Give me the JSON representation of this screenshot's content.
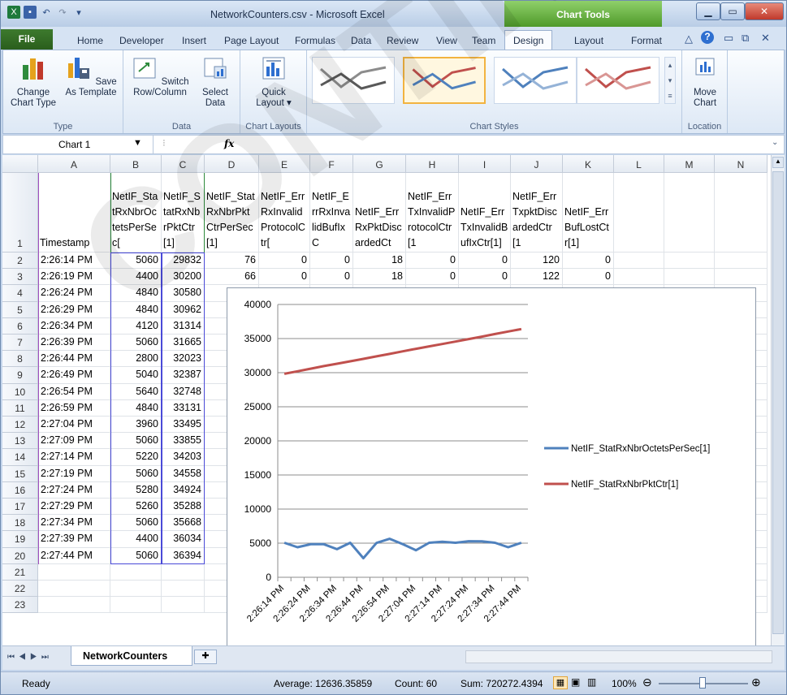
{
  "app": {
    "title": "NetworkCounters.csv - Microsoft Excel",
    "chart_tools": "Chart Tools"
  },
  "tabs": [
    "File",
    "Home",
    "Developer",
    "Insert",
    "Page Layout",
    "Formulas",
    "Data",
    "Review",
    "View",
    "Team",
    "Design",
    "Layout",
    "Format"
  ],
  "ribbon": {
    "type_group": {
      "label": "Type",
      "change": "Change Chart Type",
      "save": "Save As Template"
    },
    "data_group": {
      "label": "Data",
      "switch": "Switch Row/Column",
      "select": "Select Data"
    },
    "layouts_group": {
      "label": "Chart Layouts",
      "quick": "Quick Layout"
    },
    "styles_group": {
      "label": "Chart Styles",
      "style_colors": [
        [
          "#8c8c8c",
          "#595959"
        ],
        [
          "#c0504d",
          "#4f81bd"
        ],
        [
          "#4f81bd",
          "#95b3d7"
        ],
        [
          "#c0504d",
          "#d99694"
        ]
      ]
    },
    "location_group": {
      "label": "Location",
      "move": "Move Chart"
    }
  },
  "formula_bar": {
    "name_box": "Chart 1",
    "fx": "fx",
    "value": ""
  },
  "columns": [
    "A",
    "B",
    "C",
    "D",
    "E",
    "F",
    "G",
    "H",
    "I",
    "J",
    "K",
    "L",
    "M",
    "N"
  ],
  "header_row": [
    "Timestamp",
    "NetIF_StatRxNbrOctetsPerSec[",
    "NetIF_StatRxNbrPktCtr[1]",
    "NetIF_StatRxNbrPktCtrPerSec[1]",
    "NetIF_ErrRxInvalidProtocolCtr[",
    "NetIF_ErrRxInvalidBufIxC",
    "NetIF_ErrRxPktDiscardedCt",
    "NetIF_ErrTxInvalidProtocolCtr[1",
    "NetIF_ErrTxInvalidBufIxCtr[1]",
    "NetIF_ErrTxpktDiscardedCtr[1",
    "NetIF_ErrBufLostCtr[1]"
  ],
  "rows": [
    {
      "n": "2",
      "a": "2:26:14 PM",
      "b": "5060",
      "c": "29832",
      "d": "76",
      "e": "0",
      "f": "0",
      "g": "18",
      "h": "0",
      "i": "0",
      "j": "120",
      "k": "0"
    },
    {
      "n": "3",
      "a": "2:26:19 PM",
      "b": "4400",
      "c": "30200",
      "d": "66",
      "e": "0",
      "f": "0",
      "g": "18",
      "h": "0",
      "i": "0",
      "j": "122",
      "k": "0"
    },
    {
      "n": "4",
      "a": "2:26:24 PM",
      "b": "4840",
      "c": "30580"
    },
    {
      "n": "5",
      "a": "2:26:29 PM",
      "b": "4840",
      "c": "30962"
    },
    {
      "n": "6",
      "a": "2:26:34 PM",
      "b": "4120",
      "c": "31314"
    },
    {
      "n": "7",
      "a": "2:26:39 PM",
      "b": "5060",
      "c": "31665"
    },
    {
      "n": "8",
      "a": "2:26:44 PM",
      "b": "2800",
      "c": "32023"
    },
    {
      "n": "9",
      "a": "2:26:49 PM",
      "b": "5040",
      "c": "32387"
    },
    {
      "n": "10",
      "a": "2:26:54 PM",
      "b": "5640",
      "c": "32748"
    },
    {
      "n": "11",
      "a": "2:26:59 PM",
      "b": "4840",
      "c": "33131"
    },
    {
      "n": "12",
      "a": "2:27:04 PM",
      "b": "3960",
      "c": "33495"
    },
    {
      "n": "13",
      "a": "2:27:09 PM",
      "b": "5060",
      "c": "33855"
    },
    {
      "n": "14",
      "a": "2:27:14 PM",
      "b": "5220",
      "c": "34203"
    },
    {
      "n": "15",
      "a": "2:27:19 PM",
      "b": "5060",
      "c": "34558"
    },
    {
      "n": "16",
      "a": "2:27:24 PM",
      "b": "5280",
      "c": "34924"
    },
    {
      "n": "17",
      "a": "2:27:29 PM",
      "b": "5260",
      "c": "35288"
    },
    {
      "n": "18",
      "a": "2:27:34 PM",
      "b": "5060",
      "c": "35668"
    },
    {
      "n": "19",
      "a": "2:27:39 PM",
      "b": "4400",
      "c": "36034"
    },
    {
      "n": "20",
      "a": "2:27:44 PM",
      "b": "5060",
      "c": "36394"
    },
    {
      "n": "21"
    },
    {
      "n": "22"
    },
    {
      "n": "23"
    }
  ],
  "sheet_tab": "NetworkCounters",
  "status": {
    "ready": "Ready",
    "average": "Average: 12636.35859",
    "count": "Count: 60",
    "sum": "Sum: 720272.4394",
    "zoom": "100%"
  },
  "watermark": "CONTINUED",
  "chart_data": {
    "type": "line",
    "x": [
      "2:26:14 PM",
      "2:26:19 PM",
      "2:26:24 PM",
      "2:26:29 PM",
      "2:26:34 PM",
      "2:26:39 PM",
      "2:26:44 PM",
      "2:26:49 PM",
      "2:26:54 PM",
      "2:26:59 PM",
      "2:27:04 PM",
      "2:27:09 PM",
      "2:27:14 PM",
      "2:27:19 PM",
      "2:27:24 PM",
      "2:27:29 PM",
      "2:27:34 PM",
      "2:27:39 PM",
      "2:27:44 PM"
    ],
    "xtick_labels": [
      "2:26:14 PM",
      "2:26:24 PM",
      "2:26:34 PM",
      "2:26:44 PM",
      "2:26:54 PM",
      "2:27:04 PM",
      "2:27:14 PM",
      "2:27:24 PM",
      "2:27:34 PM",
      "2:27:44 PM"
    ],
    "ylim": [
      0,
      40000
    ],
    "yticks": [
      0,
      5000,
      10000,
      15000,
      20000,
      25000,
      30000,
      35000,
      40000
    ],
    "grid": true,
    "legend": "right",
    "series": [
      {
        "name": "NetIF_StatRxNbrOctetsPerSec[1]",
        "color": "#4f81bd",
        "values": [
          5060,
          4400,
          4840,
          4840,
          4120,
          5060,
          2800,
          5040,
          5640,
          4840,
          3960,
          5060,
          5220,
          5060,
          5280,
          5260,
          5060,
          4400,
          5060
        ]
      },
      {
        "name": "NetIF_StatRxNbrPktCtr[1]",
        "color": "#c0504d",
        "values": [
          29832,
          30200,
          30580,
          30962,
          31314,
          31665,
          32023,
          32387,
          32748,
          33131,
          33495,
          33855,
          34203,
          34558,
          34924,
          35288,
          35668,
          36034,
          36394
        ]
      }
    ]
  }
}
